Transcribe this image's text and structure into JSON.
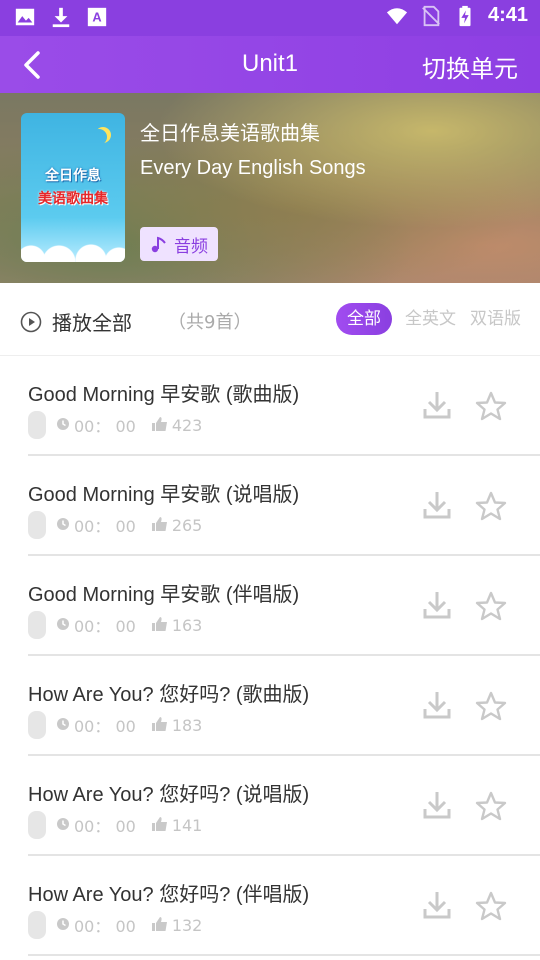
{
  "status_bar": {
    "time": "4:41",
    "icons_left": [
      "image-icon",
      "download-icon",
      "text-icon"
    ],
    "icons_right": [
      "wifi-icon",
      "no-sim-icon",
      "battery-charging-icon"
    ]
  },
  "app_bar": {
    "back_icon": "back-arrow-icon",
    "title": "Unit1",
    "switch_label": "切换单元"
  },
  "album": {
    "cover_line1": "全日作息",
    "cover_line2": "美语歌曲集",
    "title_cn": "全日作息美语歌曲集",
    "title_en": "Every Day English Songs",
    "tag_label": "音频"
  },
  "toolbar": {
    "play_all_label": "播放全部",
    "count_label": "（共9首）",
    "filters": [
      "全部",
      "全英文",
      "双语版"
    ],
    "active_filter": "全部"
  },
  "songs": [
    {
      "title": "Good Morning 早安歌 (歌曲版)",
      "duration": "00： 00",
      "likes": "423"
    },
    {
      "title": "Good Morning 早安歌 (说唱版)",
      "duration": "00： 00",
      "likes": "265"
    },
    {
      "title": "Good Morning 早安歌 (伴唱版)",
      "duration": "00： 00",
      "likes": "163"
    },
    {
      "title": "How Are You? 您好吗? (歌曲版)",
      "duration": "00： 00",
      "likes": "183"
    },
    {
      "title": "How Are You? 您好吗? (说唱版)",
      "duration": "00： 00",
      "likes": "141"
    },
    {
      "title": "How Are You? 您好吗? (伴唱版)",
      "duration": "00： 00",
      "likes": "132"
    }
  ],
  "colors": {
    "accent": "#8a3fe0",
    "status_bar": "#8a3fe0",
    "inactive_filter": "#c7c7c7"
  }
}
